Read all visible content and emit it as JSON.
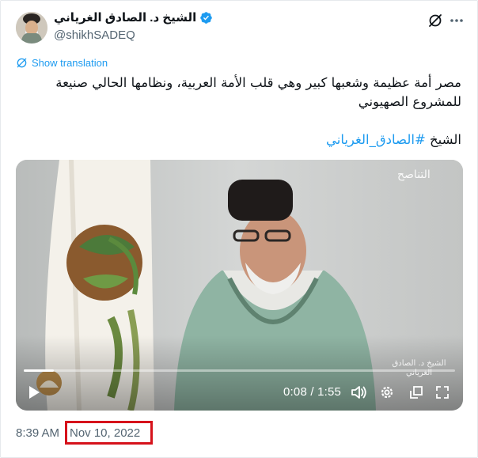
{
  "author": {
    "display_name": "الشيخ د. الصادق الغرياني",
    "handle": "@shikhSADEQ",
    "verified": true
  },
  "translation": {
    "label": "Show translation"
  },
  "tweet": {
    "text": "مصر أمة عظيمة وشعبها كبير وهي قلب الأمة العربية، ونظامها الحالي صنيعة للمشروع الصهيوني",
    "tag_prefix": "الشيخ",
    "hashtag": "#الصادق_الغرياني"
  },
  "video": {
    "watermark": "التناصح",
    "caption": "الشيخ د. الصادق الغرياني",
    "timecode": "0:08 / 1:55",
    "progress": 0.07
  },
  "meta": {
    "time": "8:39 AM",
    "separator": "·",
    "date": "Nov 10, 2022",
    "highlight_color": "#d6121b",
    "accent_color": "#1d9bf0"
  }
}
